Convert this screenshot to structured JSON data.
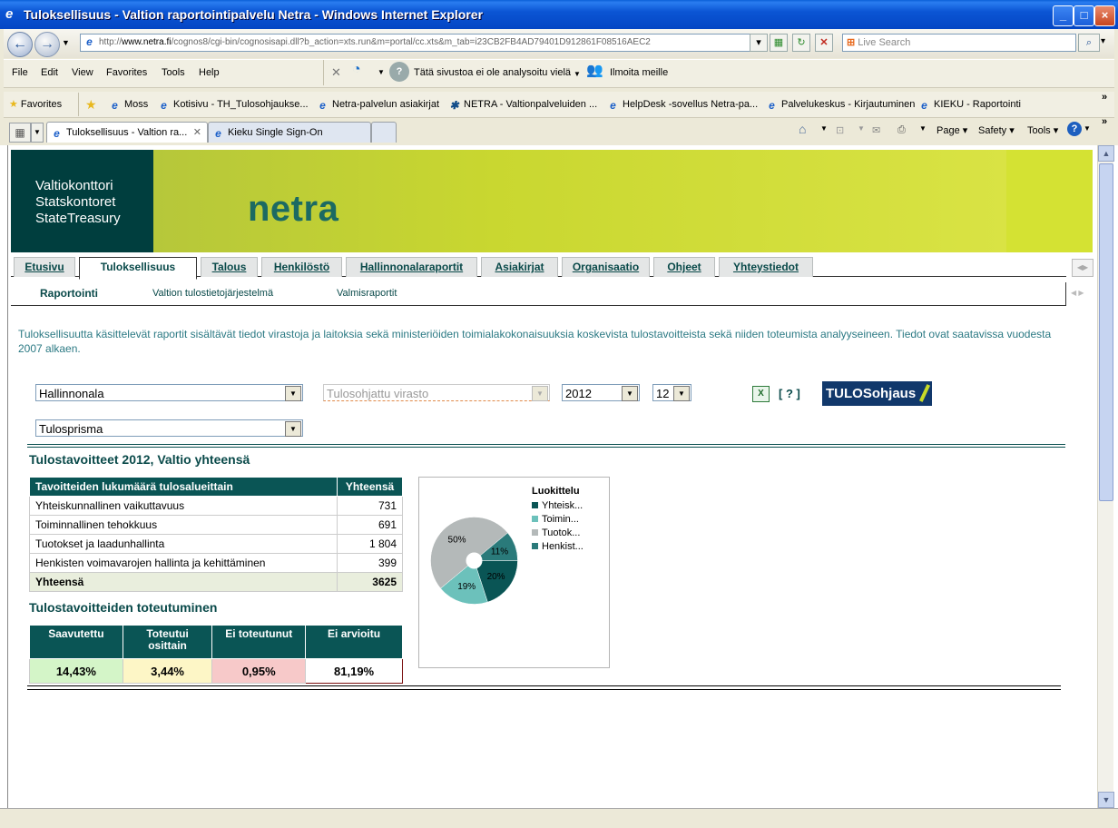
{
  "window": {
    "title": "Tuloksellisuus - Valtion raportointipalvelu Netra - Windows Internet Explorer"
  },
  "address": {
    "url_prefix": "http://",
    "url_domain": "www.netra.fi",
    "url_rest": "/cognos8/cgi-bin/cognosisapi.dll?b_action=xts.run&m=portal/cc.xts&m_tab=i23CB2FB4AD79401D912861F08516AEC2",
    "search_placeholder": "Live Search"
  },
  "menu": {
    "items": [
      "File",
      "Edit",
      "View",
      "Favorites",
      "Tools",
      "Help"
    ],
    "analysis_text": "Tätä sivustoa ei ole analysoitu vielä",
    "report_text": "Ilmoita meille"
  },
  "favorites": {
    "label": "Favorites",
    "items": [
      "Moss",
      "Kotisivu - TH_Tulosohjaukse...",
      "Netra-palvelun asiakirjat",
      "NETRA - Valtionpalveluiden ...",
      "HelpDesk -sovellus Netra-pa...",
      "Palvelukeskus - Kirjautuminen",
      "KIEKU - Raportointi"
    ]
  },
  "browser_tabs": [
    {
      "label": "Tuloksellisuus - Valtion ra..."
    },
    {
      "label": "Kieku Single Sign-On"
    }
  ],
  "command_bar": {
    "page": "Page",
    "safety": "Safety",
    "tools": "Tools"
  },
  "banner": {
    "org_lines": [
      "Valtiokonttori",
      "Statskontoret",
      "StateTreasury"
    ],
    "brand": "netra"
  },
  "section_tabs": [
    "Etusivu",
    "Tuloksellisuus",
    "Talous",
    "Henkilöstö",
    "Hallinnonalaraportit",
    "Asiakirjat",
    "Organisaatio",
    "Ohjeet",
    "Yhteystiedot"
  ],
  "sub_nav": [
    "Raportointi",
    "Valtion tulostietojärjestelmä",
    "Valmisraportit"
  ],
  "intro_text": "Tuloksellisuutta käsittelevät raportit sisältävät tiedot virastoja ja laitoksia sekä ministeriöiden toimialakokonaisuuksia koskevista tulostavoitteista sekä niiden toteumista analyyseineen. Tiedot ovat saatavissa vuodesta 2007 alkaen.",
  "filters": {
    "hallinnonala": "Hallinnonala",
    "virasto_placeholder": "Tulosohjattu virasto",
    "year": "2012",
    "month": "12",
    "view": "Tulosprisma",
    "help_link": "[ ? ]",
    "logo_text": "TULOSohjaus"
  },
  "main_heading": "Tulostavoitteet 2012, Valtio yhteensä",
  "table1": {
    "headers": [
      "Tavoitteiden lukumäärä tulosalueittain",
      "Yhteensä"
    ],
    "rows": [
      [
        "Yhteiskunnallinen vaikuttavuus",
        "731"
      ],
      [
        "Toiminnallinen tehokkuus",
        "691"
      ],
      [
        "Tuotokset ja laadunhallinta",
        "1 804"
      ],
      [
        "Henkisten voimavarojen hallinta ja kehittäminen",
        "399"
      ]
    ],
    "total": [
      "Yhteensä",
      "3625"
    ]
  },
  "sub_heading": "Tulostavoitteiden toteutuminen",
  "table2": {
    "headers": [
      "Saavutettu",
      "Toteutui osittain",
      "Ei toteutunut",
      "Ei arvioitu"
    ],
    "values": [
      "14,43%",
      "3,44%",
      "0,95%",
      "81,19%"
    ],
    "colors": [
      "#d4f5c8",
      "#fdf6c6",
      "#f7c9c9",
      "#ffffff"
    ]
  },
  "chart_data": {
    "type": "pie",
    "title": "",
    "legend_title": "Luokittelu",
    "categories": [
      "Yhteisk...",
      "Toimin...",
      "Tuotok...",
      "Henkist..."
    ],
    "values": [
      20,
      19,
      50,
      11
    ],
    "colors": [
      "#0a5555",
      "#6cc1bb",
      "#b4b9b9",
      "#2a7a7a"
    ],
    "legend_placement": "top-right"
  }
}
